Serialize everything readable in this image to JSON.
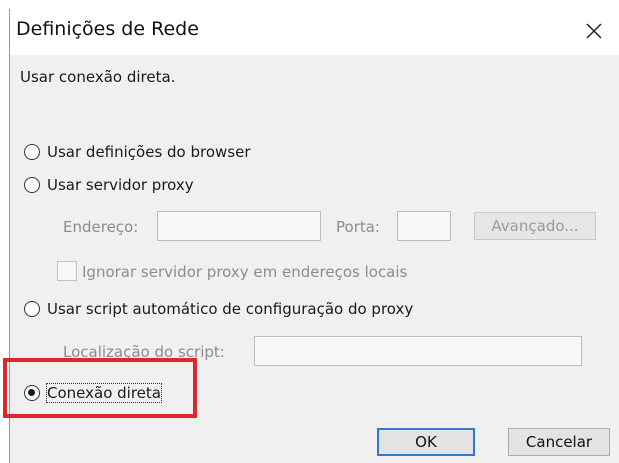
{
  "dialog": {
    "title": "Definições de Rede",
    "status": "Usar conexão direta."
  },
  "options": {
    "browser": "Usar definições do browser",
    "proxy": "Usar servidor proxy",
    "script": "Usar script automático de configuração do proxy",
    "direct": "Conexão direta"
  },
  "proxy": {
    "address_label": "Endereço:",
    "address_value": "",
    "port_label": "Porta:",
    "port_value": "",
    "advanced_label": "Avançado...",
    "bypass_label": "Ignorar servidor proxy em endereços locais"
  },
  "script": {
    "location_label": "Localização do script:",
    "location_value": ""
  },
  "buttons": {
    "ok": "OK",
    "cancel": "Cancelar"
  },
  "selected_option": "direct",
  "colors": {
    "highlight": "#e0252d",
    "ok_border": "#2f78d6"
  }
}
